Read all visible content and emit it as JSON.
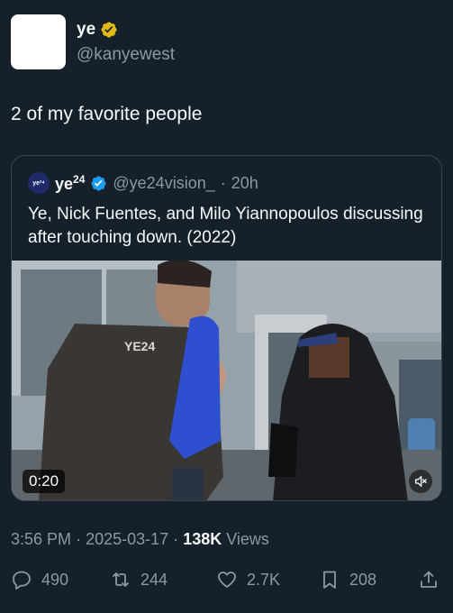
{
  "author": {
    "display_name": "ye",
    "handle": "@kanyewest",
    "verified_badge_icon": "gold-check-icon"
  },
  "tweet": {
    "text": "2 of my favorite people"
  },
  "quoted": {
    "avatar_text": "ye²⁴",
    "display_name": "ye",
    "name_super": "24",
    "handle": "@ye24vision_",
    "separator": "·",
    "time": "20h",
    "text": "Ye, Nick Fuentes, and Milo Yiannopoulos discussing after touching down. (2022)",
    "video": {
      "duration": "0:20",
      "jacket_text": "YE24",
      "mute_icon": "volume-muted-icon"
    }
  },
  "meta": {
    "time": "3:56 PM",
    "separator1": "·",
    "date": "2025-03-17",
    "separator2": "·",
    "views_count": "138K",
    "views_label": "Views"
  },
  "actions": {
    "replies": "490",
    "reposts": "244",
    "likes": "2.7K",
    "bookmarks": "208"
  },
  "colors": {
    "background": "#15202b",
    "text_primary": "#f7f9f9",
    "text_secondary": "#8b98a5",
    "border": "#38444d",
    "gold_badge": "#e2b719",
    "blue_badge": "#1d9bf0"
  }
}
